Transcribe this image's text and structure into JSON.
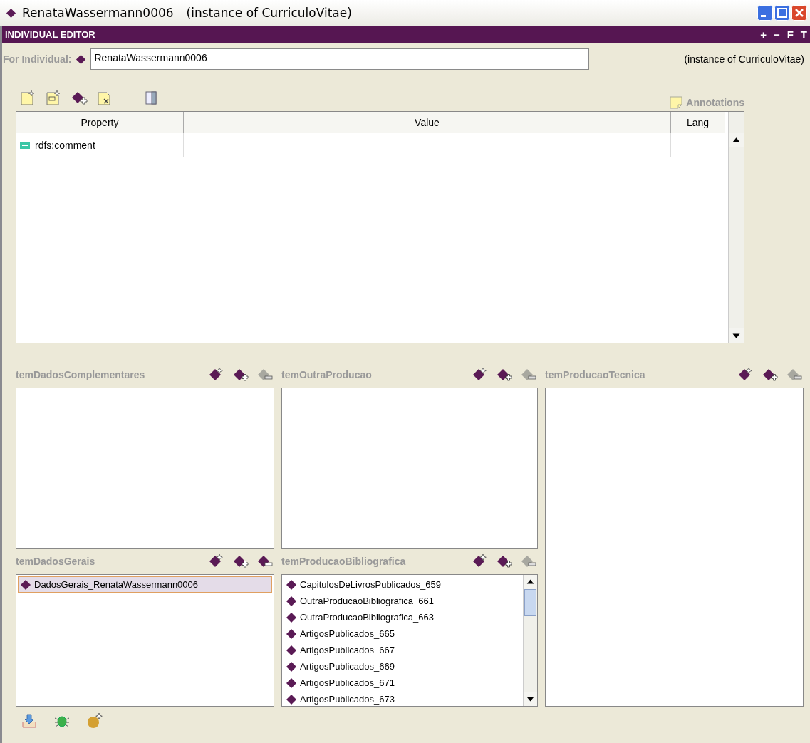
{
  "window": {
    "title": "RenataWassermann0006",
    "subtitle": "(instance of CurriculoVitae)"
  },
  "editor": {
    "title": "INDIVIDUAL EDITOR",
    "buttons": [
      "+",
      "−",
      "F",
      "T"
    ]
  },
  "individual": {
    "label": "For Individual:",
    "value": "RenataWassermann0006",
    "type": "(instance of CurriculoVitae)"
  },
  "annotations": {
    "label": "Annotations"
  },
  "table": {
    "columns": [
      "Property",
      "Value",
      "Lang"
    ],
    "rows": [
      {
        "property": "rdfs:comment",
        "value": "",
        "lang": ""
      }
    ]
  },
  "slots": [
    {
      "title": "temDadosComplementares",
      "remove_enabled": false
    },
    {
      "title": "temOutraProducao",
      "remove_enabled": false
    },
    {
      "title": "temProducaoTecnica",
      "remove_enabled": false
    },
    {
      "title": "temDadosGerais",
      "remove_enabled": true,
      "items": [
        {
          "label": "DadosGerais_RenataWassermann0006",
          "selected": true
        }
      ]
    },
    {
      "title": "temProducaoBibliografica",
      "remove_enabled": false,
      "items": [
        {
          "label": "CapitulosDeLivrosPublicados_659",
          "selected": false
        },
        {
          "label": "OutraProducaoBibliografica_661",
          "selected": false
        },
        {
          "label": "OutraProducaoBibliografica_663",
          "selected": false
        },
        {
          "label": "ArtigosPublicados_665",
          "selected": false
        },
        {
          "label": "ArtigosPublicados_667",
          "selected": false
        },
        {
          "label": "ArtigosPublicados_669",
          "selected": false
        },
        {
          "label": "ArtigosPublicados_671",
          "selected": false
        },
        {
          "label": "ArtigosPublicados_673",
          "selected": false
        }
      ]
    }
  ]
}
